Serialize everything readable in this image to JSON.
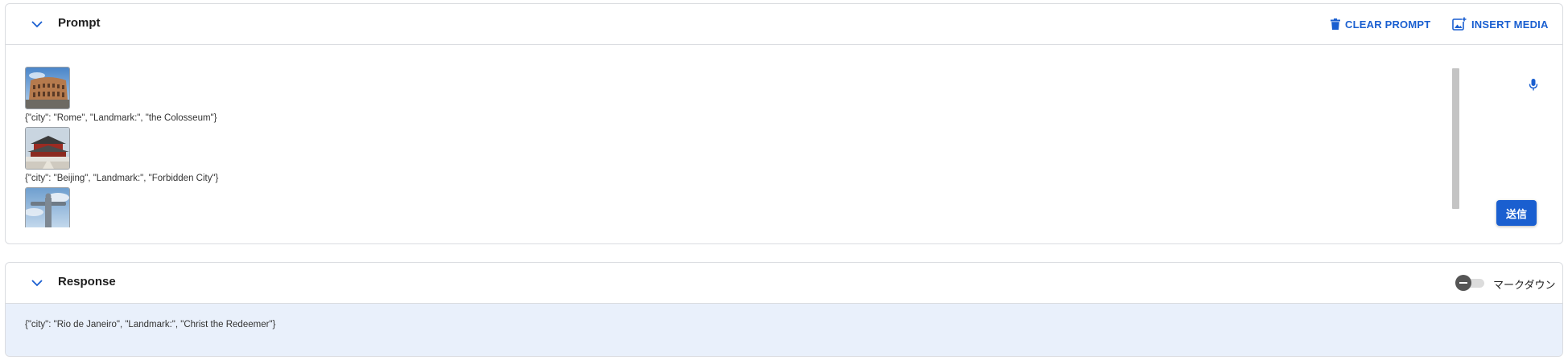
{
  "colors": {
    "accent": "#1a5fd0",
    "response_bg": "#e9f0fb"
  },
  "prompt": {
    "title": "Prompt",
    "clear_label": "CLEAR PROMPT",
    "insert_label": "INSERT MEDIA",
    "entries": [
      {
        "image": "colosseum-photo",
        "text": "{\"city\": \"Rome\", \"Landmark:\", \"the Colosseum\"}"
      },
      {
        "image": "forbidden-city-photo",
        "text": "{\"city\": \"Beijing\", \"Landmark:\", \"Forbidden City\"}"
      },
      {
        "image": "christ-the-redeemer-photo",
        "text": ""
      }
    ],
    "send_label": "送信",
    "icons": [
      "chevron-down-icon",
      "trash-icon",
      "image-add-icon",
      "microphone-icon"
    ]
  },
  "response": {
    "title": "Response",
    "markdown_label": "マークダウン",
    "markdown_on": false,
    "text": "{\"city\": \"Rio de Janeiro\", \"Landmark:\", \"Christ the Redeemer\"}"
  }
}
